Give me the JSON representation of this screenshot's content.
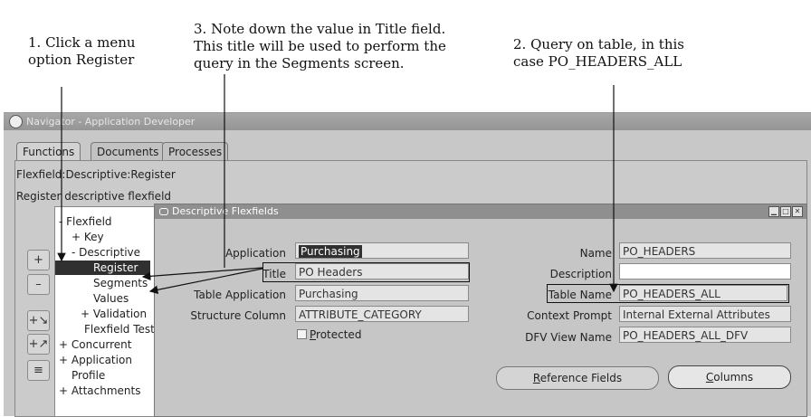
{
  "annotations": {
    "step1": "1. Click a menu\noption Register",
    "step3": "3. Note down the value in Title field.\nThis title will be used to perform the\nquery in the Segments screen.",
    "step2": "2. Query on table, in this\ncase PO_HEADERS_ALL"
  },
  "navigator": {
    "title": "Navigator - Application Developer",
    "tabs": [
      "Functions",
      "Documents",
      "Processes"
    ],
    "breadcrumb": "Flexfield:Descriptive:Register",
    "description": "Register descriptive flexfield",
    "tree": [
      "- Flexfield",
      "+ Key",
      "- Descriptive",
      "Register",
      "Segments",
      "Values",
      "+ Validation",
      "Flexfield Test",
      "+ Concurrent",
      "+ Application",
      "Profile",
      "+ Attachments"
    ],
    "side_buttons": [
      "+",
      "–",
      "+↘",
      "+↗",
      "≡"
    ]
  },
  "dff": {
    "title": "Descriptive Flexfields",
    "labels": {
      "application": "Application",
      "title": "Title",
      "table_application": "Table Application",
      "structure_column": "Structure Column",
      "name": "Name",
      "description": "Description",
      "table_name": "Table Name",
      "context_prompt": "Context Prompt",
      "dfv_view_name": "DFV View Name"
    },
    "values": {
      "application": "Purchasing",
      "title": "PO Headers",
      "table_application": "Purchasing",
      "structure_column": "ATTRIBUTE_CATEGORY",
      "name": "PO_HEADERS",
      "description": "",
      "table_name": "PO_HEADERS_ALL",
      "context_prompt": "Internal External Attributes",
      "dfv_view_name": "PO_HEADERS_ALL_DFV"
    },
    "protected": {
      "rest": "rotected",
      "mnemonic": "P",
      "checked": false
    },
    "reference_fields": {
      "mnemonic": "R",
      "rest": "eference Fields"
    },
    "columns": {
      "mnemonic": "C",
      "rest": "olumns"
    }
  }
}
